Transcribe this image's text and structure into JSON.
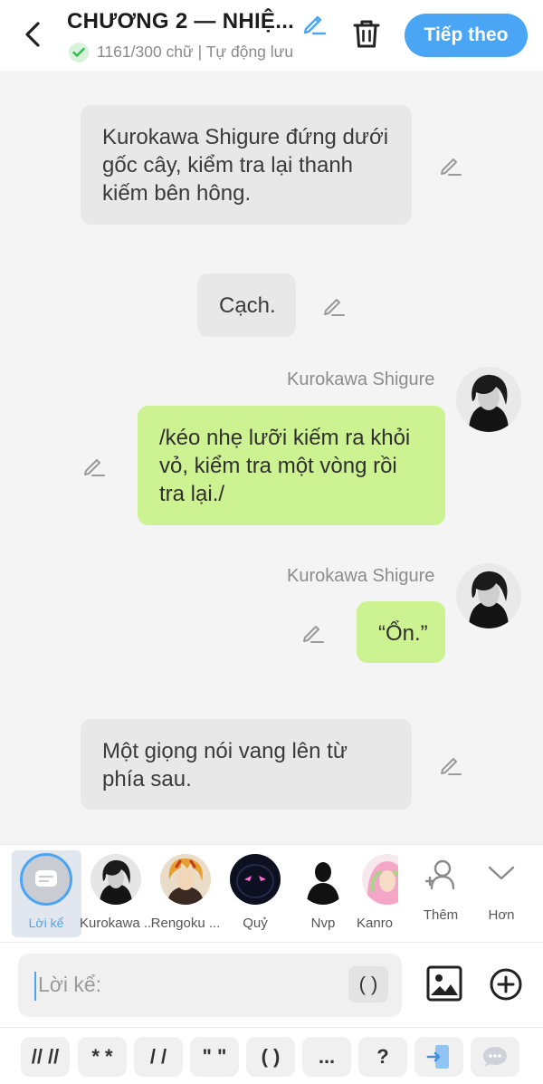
{
  "header": {
    "title": "CHƯƠNG 2 — NHIỆ...",
    "status": "1161/300 chữ | Tự động lưu",
    "next_label": "Tiếp theo"
  },
  "messages": [
    {
      "type": "narration",
      "text": "Kurokawa Shigure đứng dưới gốc cây, kiểm tra lại thanh kiếm bên hông."
    },
    {
      "type": "narration",
      "text": "Cạch."
    },
    {
      "type": "character",
      "speaker": "Kurokawa Shigure",
      "text": "/kéo nhẹ lưỡi kiếm ra khỏi vỏ, kiểm tra một vòng rồi tra lại./"
    },
    {
      "type": "character",
      "speaker": "Kurokawa Shigure",
      "text": "“Ổn.”"
    },
    {
      "type": "narration",
      "text": "Một giọng nói vang lên từ phía sau."
    }
  ],
  "characters": [
    {
      "label": "Lời kể",
      "selected": true
    },
    {
      "label": "Kurokawa ..."
    },
    {
      "label": "Rengoku ..."
    },
    {
      "label": "Quỷ"
    },
    {
      "label": "Nvp"
    },
    {
      "label": "Kanro"
    },
    {
      "label": "Thêm",
      "icon": "add-person-icon"
    },
    {
      "label": "Hơn",
      "icon": "chevron-down-icon"
    }
  ],
  "input": {
    "placeholder": "Lời kể:",
    "paren_label": "( )"
  },
  "symbols": [
    "// //",
    "* *",
    "/ /",
    "\" \"",
    "( )",
    "...",
    "?"
  ],
  "colors": {
    "accent": "#4aa5f5",
    "character_bubble": "#cdf291",
    "narration_bubble": "#e8e8e8"
  }
}
